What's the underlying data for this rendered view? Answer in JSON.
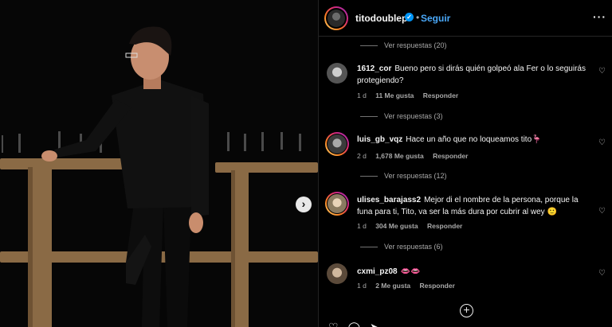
{
  "post": {
    "next_icon": "chevron-right-icon",
    "next_symbol": "›"
  },
  "header": {
    "username": "titodoublep",
    "verified_symbol": "✓",
    "separator": "•",
    "follow_label": "Seguir",
    "more_symbol": "···"
  },
  "comments": [
    {
      "view_replies_before": "Ver respuestas (20)"
    },
    {
      "username": "1612_cor",
      "text": "Bueno pero si dirás quién golpeó ala Fer o lo seguirás protegiendo?",
      "time": "1 d",
      "likes": "11 Me gusta",
      "reply": "Responder",
      "view_replies": "Ver respuestas (3)"
    },
    {
      "username": "luis_gb_vqz",
      "text": "Hace un año que no loqueamos tito🦩",
      "time": "2 d",
      "likes": "1,678 Me gusta",
      "reply": "Responder",
      "view_replies": "Ver respuestas (12)"
    },
    {
      "username": "ulises_barajass2",
      "text": "Mejor di el nombre de la persona, porque la funa para ti, Tito, va ser la más dura por cubrir al wey 🙂",
      "time": "1 d",
      "likes": "304 Me gusta",
      "reply": "Responder",
      "view_replies": "Ver respuestas (6)"
    },
    {
      "username": "cxmi_pz08",
      "text": "👄👄",
      "time": "1 d",
      "likes": "2 Me gusta",
      "reply": "Responder"
    }
  ],
  "heart_symbol": "♡",
  "load_more_symbol": "+",
  "bottom_bar": {
    "like_symbol": "♡",
    "comment_symbol": "◯",
    "share_symbol": "➤"
  }
}
